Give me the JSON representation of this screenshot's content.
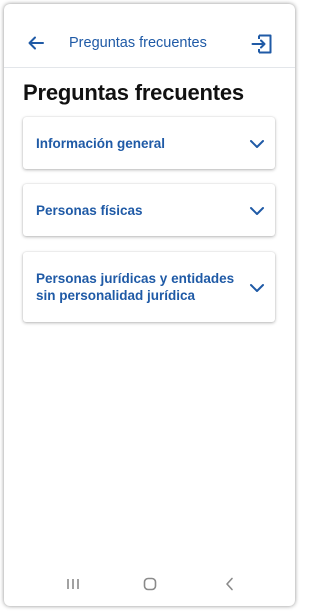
{
  "topbar": {
    "title": "Preguntas frecuentes",
    "back_icon": "arrow-left-icon",
    "exit_icon": "exit-icon"
  },
  "page": {
    "title": "Preguntas frecuentes"
  },
  "sections": [
    {
      "label": "Información general",
      "expanded": false
    },
    {
      "label": "Personas físicas",
      "expanded": false
    },
    {
      "label": "Personas jurídicas y entidades sin personalidad jurídica",
      "expanded": false
    }
  ],
  "navbar": {
    "recents_icon": "recents-icon",
    "home_icon": "home-icon",
    "back_icon": "back-chevron-icon"
  },
  "colors": {
    "accent": "#1f5aa6",
    "title": "#111111",
    "background": "#ffffff"
  }
}
